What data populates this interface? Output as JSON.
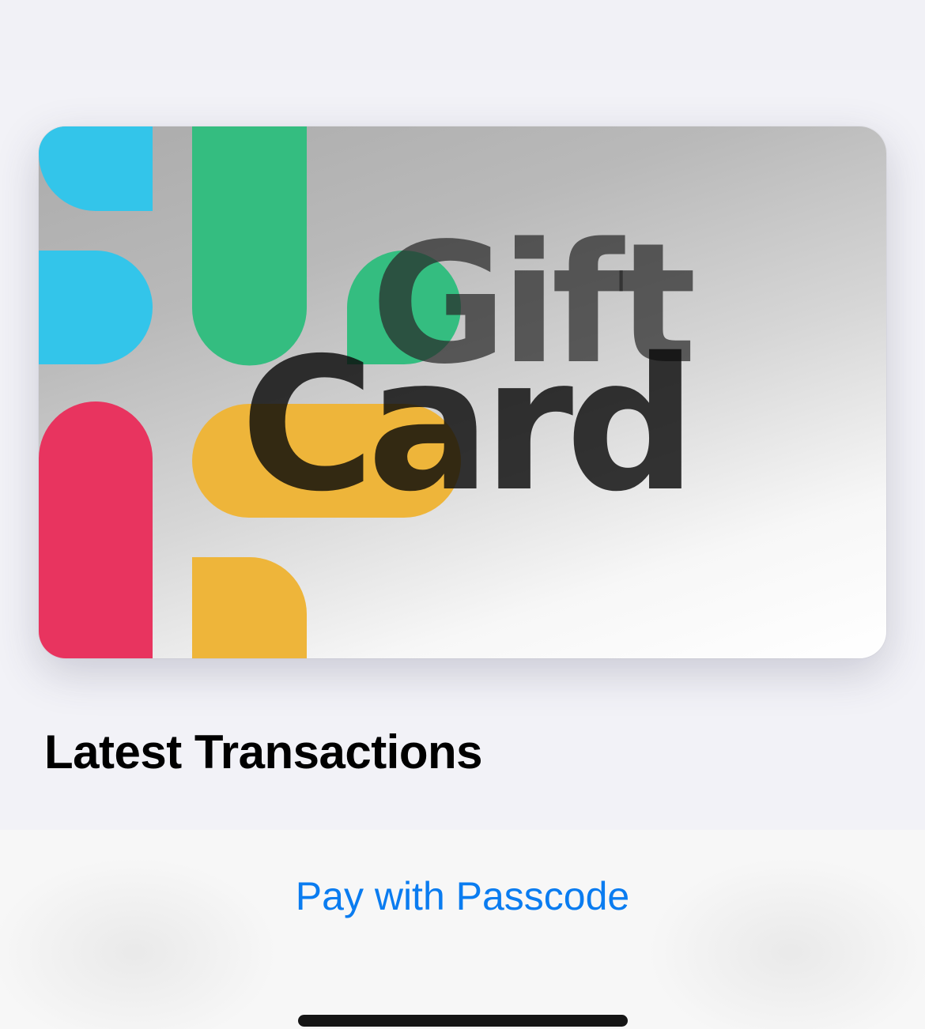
{
  "card": {
    "title_line1": "Gift",
    "title_line2": "Card",
    "logo_colors": {
      "blue": "#33C5EA",
      "green": "#34BD80",
      "red": "#E8345F",
      "yellow": "#EEB53A"
    }
  },
  "transactions": {
    "heading": "Latest Transactions"
  },
  "actions": {
    "pay_with_passcode": "Pay with Passcode"
  },
  "colors": {
    "accent": "#0A7CF0",
    "background": "#F2F2F7"
  }
}
